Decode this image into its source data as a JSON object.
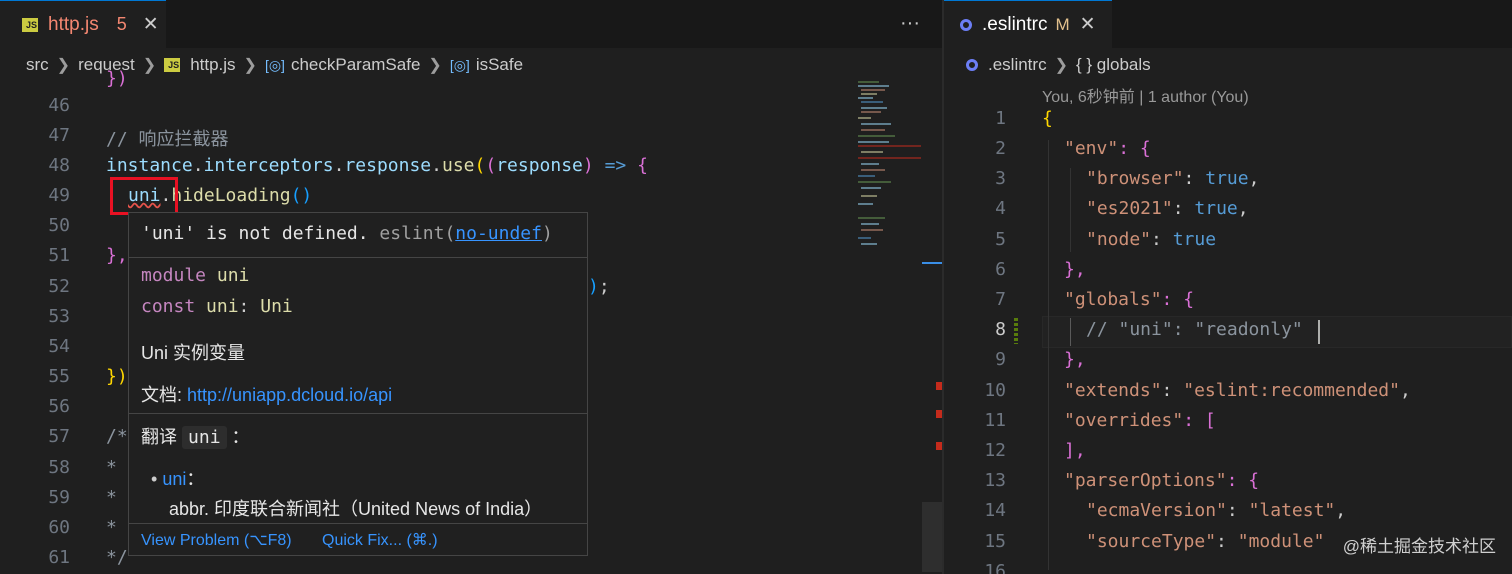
{
  "left_editor": {
    "tab": {
      "icon": "js-file-icon",
      "title": "http.js",
      "problems_badge": "5",
      "more_actions": "···"
    },
    "breadcrumb": [
      {
        "label": "src",
        "icon": ""
      },
      {
        "label": "request",
        "icon": ""
      },
      {
        "label": "http.js",
        "icon": "js-file-icon"
      },
      {
        "label": "checkParamSafe",
        "icon": "symbol-variable-icon"
      },
      {
        "label": "isSafe",
        "icon": "symbol-variable-icon"
      }
    ],
    "line_numbers": [
      "46",
      "47",
      "48",
      "49",
      "50",
      "51",
      "52",
      "53",
      "54",
      "55",
      "56",
      "57",
      "58",
      "59",
      "60",
      "61"
    ],
    "partial_top_line": "})",
    "code": {
      "l47": "// 响应拦截器",
      "l48_obj": "instance",
      "l48_p1": "interceptors",
      "l48_p2": "response",
      "l48_fn": "use",
      "l48_param": "response",
      "l48_arrow": "=>",
      "l49_obj": "uni",
      "l49_fn": "hideLoading",
      "l51": "},",
      "l52_tail": ");",
      "l55": "})",
      "l57": "/*",
      "l58": "*",
      "l59": "*",
      "l60": "*",
      "l61": "*/"
    },
    "hover": {
      "error_message": "'uni' is not defined.",
      "source": "eslint(",
      "rule": "no-undef",
      "source_close": ")",
      "decl1_kw": "module",
      "decl1_name": "uni",
      "decl2_kw": "const",
      "decl2_name": "uni",
      "decl2_type": "Uni",
      "description": "Uni 实例变量",
      "doc_label": "文档: ",
      "doc_link": "http://uniapp.dcloud.io/api",
      "translate_label": "翻译",
      "translate_word": "uni",
      "translate_colon": "：",
      "entry_word": "uni",
      "entry_colon": "：",
      "entry_text": "abbr. 印度联合新闻社（United News of India）",
      "action_view_problem": "View Problem (⌥F8)",
      "action_quick_fix": "Quick Fix... (⌘.)"
    }
  },
  "right_editor": {
    "tab": {
      "icon": "eslint-config-icon",
      "title": ".eslintrc",
      "modified_badge": "M",
      "close": "✕"
    },
    "breadcrumb": [
      {
        "label": ".eslintrc",
        "icon": "eslint-config-icon"
      },
      {
        "label": "{ } globals",
        "icon": ""
      }
    ],
    "codelens": "You, 6秒钟前 | 1 author (You)",
    "line_numbers": [
      "1",
      "2",
      "3",
      "4",
      "5",
      "6",
      "7",
      "8",
      "9",
      "10",
      "11",
      "12",
      "13",
      "14",
      "15",
      "16"
    ],
    "json_lines": {
      "l1": "{",
      "l2_key": "\"env\"",
      "l2_rest": ": {",
      "l3_key": "\"browser\"",
      "l3_val": "true",
      "l3_tail": ",",
      "l4_key": "\"es2021\"",
      "l4_val": "true",
      "l4_tail": ",",
      "l5_key": "\"node\"",
      "l5_val": "true",
      "l6": "},",
      "l7_key": "\"globals\"",
      "l7_rest": ": {",
      "l8_comment": "// \"uni\": \"readonly\"",
      "l9": "},",
      "l10_key": "\"extends\"",
      "l10_val": "\"eslint:recommended\"",
      "l10_tail": ",",
      "l11_key": "\"overrides\"",
      "l11_rest": ": [",
      "l12": "],",
      "l13_key": "\"parserOptions\"",
      "l13_rest": ": {",
      "l14_key": "\"ecmaVersion\"",
      "l14_val": "\"latest\"",
      "l14_tail": ",",
      "l15_key": "\"sourceType\"",
      "l15_val": "\"module\""
    }
  },
  "watermark": "@稀土掘金技术社区",
  "colors": {
    "accent": "#0078d4",
    "error": "#c42b1c",
    "link": "#3794ff",
    "js_icon": "#cbcb41",
    "highlight_box": "#e81123"
  }
}
